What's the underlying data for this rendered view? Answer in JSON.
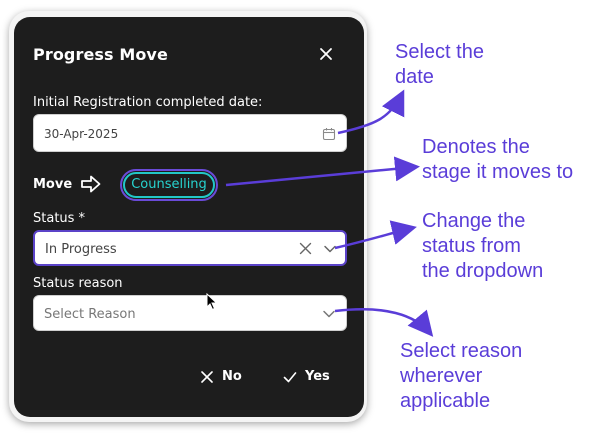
{
  "dialog": {
    "title": "Progress Move",
    "date_label": "Initial Registration completed date:",
    "date_value": "30-Apr-2025",
    "move_label": "Move",
    "stage": "Counselling",
    "status_label": "Status *",
    "status_value": "In Progress",
    "reason_label": "Status reason",
    "reason_placeholder": "Select Reason",
    "no_label": "No",
    "yes_label": "Yes"
  },
  "annotations": {
    "select_date": [
      "Select the",
      "date"
    ],
    "stage": [
      "Denotes the",
      "stage it moves to"
    ],
    "status": [
      "Change the",
      "status from",
      "the dropdown"
    ],
    "reason": [
      "Select reason",
      "wherever",
      "applicable"
    ]
  },
  "colors": {
    "accent_purple": "#5a3dd8",
    "stage_teal": "#27d3cf",
    "dialog_bg": "#1d1d1d"
  },
  "icons": [
    "close-icon",
    "calendar-icon",
    "arrow-right-icon",
    "clear-icon",
    "chevron-down-icon",
    "x-icon",
    "check-icon",
    "mouse-cursor-icon"
  ]
}
